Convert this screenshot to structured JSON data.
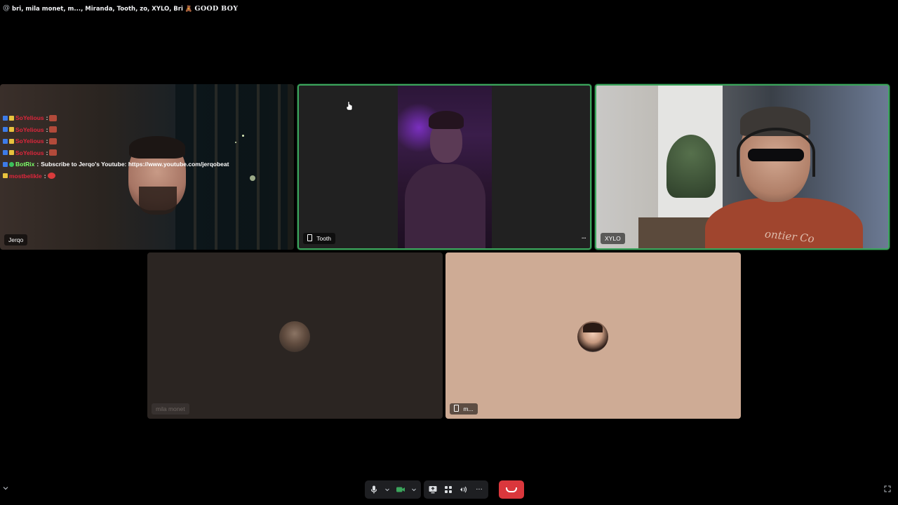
{
  "header": {
    "at_symbol": "@",
    "title": "bri, mila monet, m..., Miranda, Tooth, zo, XYLO, Bri",
    "title_emoji": "🧸",
    "title_suffix": "GOOD BOY"
  },
  "tiles": {
    "jerqo": {
      "name": "Jerqo"
    },
    "tooth": {
      "name": "Tooth",
      "more": "···"
    },
    "xylo": {
      "name": "XYLO",
      "shirt_text": "ontier Co"
    },
    "mila": {
      "name": "mila monet"
    },
    "m": {
      "name": "m..."
    }
  },
  "overlay_chat": {
    "lines": [
      {
        "user": "SoYelious",
        "sep": ":"
      },
      {
        "user": "SoYelious",
        "sep": ":"
      },
      {
        "user": "SoYelious",
        "sep": ":"
      },
      {
        "user": "SoYelious",
        "sep": ":"
      },
      {
        "user": "BotRix",
        "sep": ":",
        "message": "Subscribe to Jerqo's Youtube: https://www.youtube.com/jerqobeat"
      },
      {
        "user": "mostbelikle",
        "sep": ":"
      }
    ]
  },
  "controls": {
    "mic_icon": "microphone-icon",
    "camera_icon": "camera-icon",
    "screen_share_icon": "screen-share-icon",
    "activities_icon": "activities-icon",
    "soundboard_icon": "soundboard-icon",
    "more_icon": "more-icon",
    "leave_icon": "hang-up-icon",
    "more_glyph": "···"
  },
  "colors": {
    "speaking_border": "#3ba55c",
    "leave_button": "#da373c",
    "background": "#000000"
  }
}
